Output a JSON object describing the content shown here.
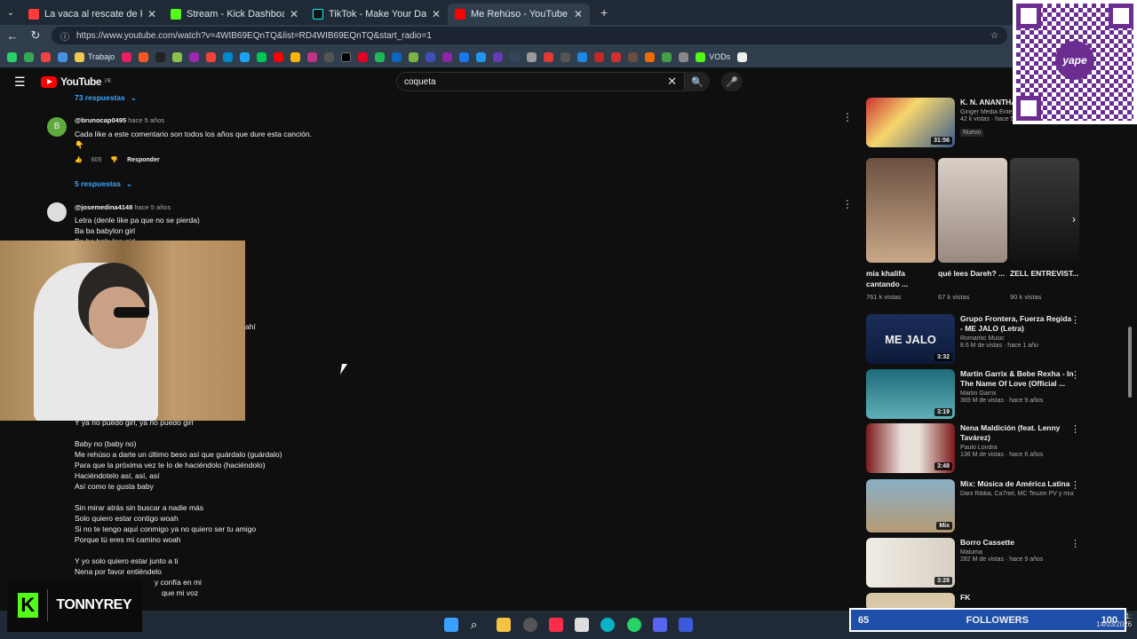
{
  "tabs": [
    {
      "title": "La vaca al rescate de Pio chicken",
      "color": "#ff3b3b"
    },
    {
      "title": "Stream - Kick Dashboard",
      "color": "#53fc18"
    },
    {
      "title": "TikTok - Make Your Day",
      "color": "#111111"
    },
    {
      "title": "Me Rehúso - YouTube",
      "color": "#ff0000"
    }
  ],
  "address": {
    "url": "https://www.youtube.com/watch?v=4WIB69EQnTQ&list=RD4WIB69EQnTQ&start_radio=1"
  },
  "bookmarks": {
    "trabajo": "Trabajo",
    "vods": "VODs"
  },
  "youtube": {
    "logo": "YouTube",
    "region": "PE",
    "search_query": "coqueta"
  },
  "comments": {
    "top_replies": "73 respuestas",
    "c1": {
      "author": "@brunocap0495",
      "time": "hace 5 años",
      "text": "Cada like a este comentario son todos los años que dure esta canción.",
      "emoji": "👇",
      "likes": "605",
      "reply_label": "Responder",
      "replies": "5 respuestas"
    },
    "c2": {
      "author": "@josemedina4148",
      "time": "hace 5 años",
      "lines": [
        "Letra (denle like pa que no se pierda)",
        "Ba ba babylon girl",
        "Ba ba babylon girl"
      ],
      "tail": "Y ya no puedo girl, ya no puedo girl",
      "v1": [
        "Baby no (baby no)",
        "Me rehúso a darte un último beso así que guárdalo (guárdalo)",
        "Para que la próxima vez te lo de haciéndolo (haciéndolo)",
        "Haciéndotelo así, así, así",
        "Así como te gusta baby"
      ],
      "v2": [
        "Sin mirar atrás sin buscar a nadie más",
        "Solo quiero estar contigo woah",
        "Si no te tengo aquí conmigo ya no quiero ser tu amigo",
        "Porque tú eres mi camino woah"
      ],
      "v3": [
        "Y yo solo quiero estar junto a ti",
        "Nena por favor entiéndelo"
      ],
      "partial1": "y confía en mi",
      "partial2": "que mi voz",
      "frag_ahi": "ahí"
    }
  },
  "sidebar": {
    "top": {
      "title": "K. N. ANANTHAPADM",
      "channel": "Ginger Media Ente",
      "meta": "42 k vistas · hace 5 días",
      "badge": "Nuevo",
      "duration": "31:56"
    },
    "shorts": [
      {
        "title": "mia khalifa cantando ...",
        "views": "761 k vistas"
      },
      {
        "title": "qué lees Dareh? ...",
        "views": "67 k vistas"
      },
      {
        "title": "ZELL ENTREVIST...",
        "views": "90 k vistas"
      }
    ],
    "videos": [
      {
        "title": "Grupo Frontera, Fuerza Regida - ME JALO (Letra)",
        "channel": "Romantic Music",
        "meta": "8.6 M de vistas · hace 1 año",
        "duration": "3:32",
        "thumb_text": "ME JALO"
      },
      {
        "title": "Martin Garrix & Bebe Rexha - In The Name Of Love (Official ...",
        "channel": "Martin Garrix",
        "meta": "369 M de vistas · hace 9 años",
        "duration": "3:19"
      },
      {
        "title": "Nena Maldición (feat. Lenny Tavárez)",
        "channel": "Paulo Londra",
        "meta": "136 M de vistas · hace 6 años",
        "duration": "3:48"
      },
      {
        "title": "Mix: Música de América Latina",
        "channel": "Dani Ribba, Ca7riel, MC Teuzin PV y muc...",
        "meta": "",
        "duration": "Mix"
      },
      {
        "title": "Borro Cassette",
        "channel": "Maluma",
        "meta": "282 M de vistas · hace 9 años",
        "duration": "3:28"
      },
      {
        "title": "FK",
        "channel": "",
        "meta": "",
        "duration": ""
      }
    ]
  },
  "overlay": {
    "yape": "yape",
    "kick_name": "TONNYREY",
    "followers_count": "65",
    "followers_label": "FOLLOWERS",
    "goal": "100"
  },
  "clock": {
    "time": "1:",
    "date": "14/03/2026"
  }
}
